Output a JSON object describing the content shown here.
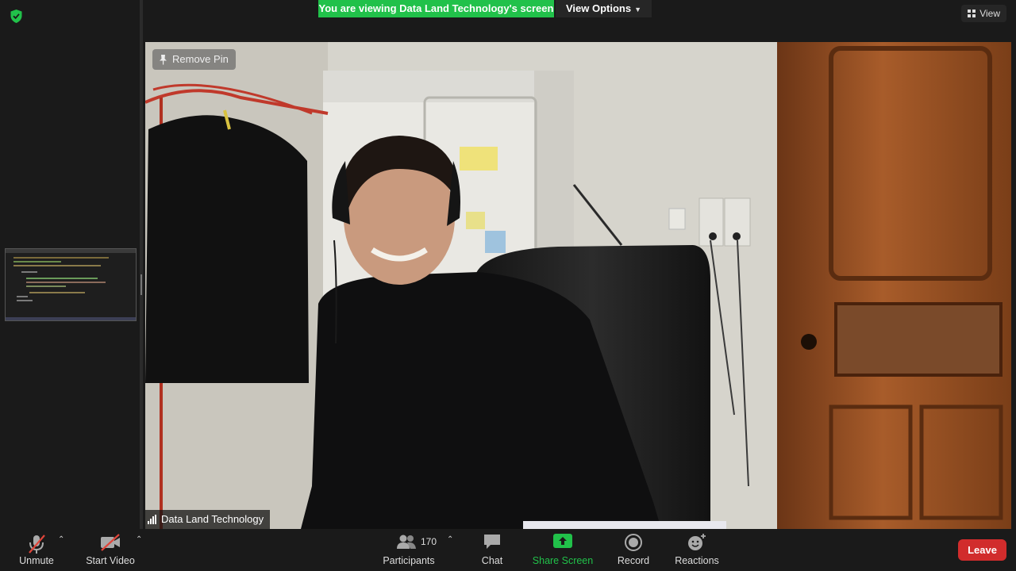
{
  "top": {
    "banner_text": "You are viewing Data Land Technology's screen",
    "view_options_label": "View Options",
    "view_label": "View",
    "accent": "#21c14a"
  },
  "video": {
    "remove_pin_label": "Remove Pin",
    "participant_name": "Data Land Technology"
  },
  "toolbar": {
    "unmute_label": "Unmute",
    "start_video_label": "Start Video",
    "participants_label": "Participants",
    "participants_count": "170",
    "chat_label": "Chat",
    "share_screen_label": "Share Screen",
    "record_label": "Record",
    "reactions_label": "Reactions",
    "leave_label": "Leave",
    "leave_color": "#d12c2c"
  },
  "icons": [
    "shield-icon",
    "grid-icon",
    "pin-icon",
    "signal-icon",
    "mic-muted-icon",
    "video-off-icon",
    "participants-icon",
    "chat-icon",
    "share-screen-icon",
    "record-icon",
    "reactions-icon",
    "chevron-up-icon"
  ]
}
